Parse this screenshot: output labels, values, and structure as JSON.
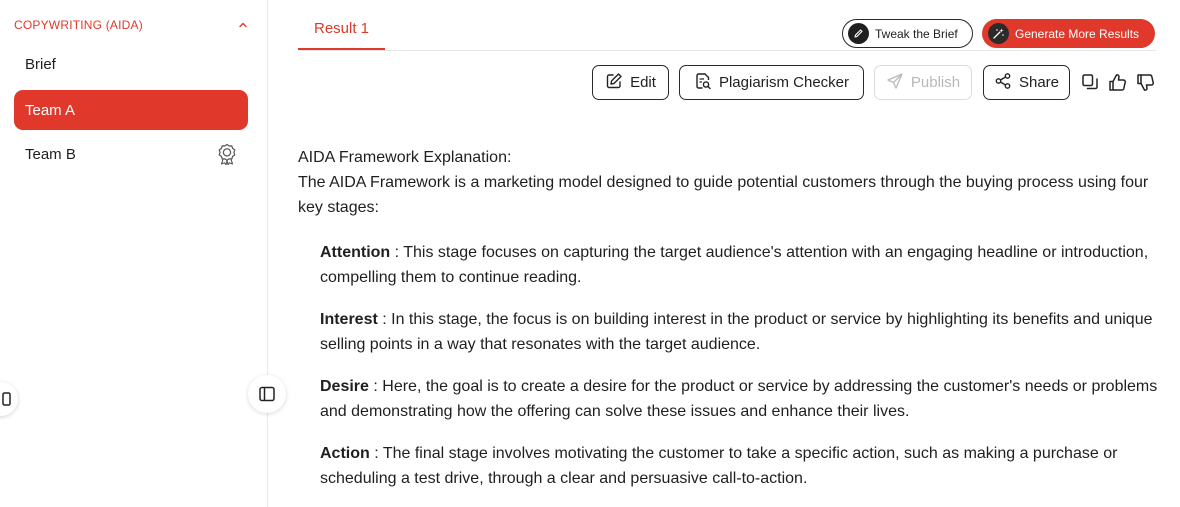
{
  "sidebar": {
    "section_title": "COPYWRITING (AIDA)",
    "items": [
      {
        "label": "Brief"
      },
      {
        "label": "Team A"
      },
      {
        "label": "Team B"
      }
    ]
  },
  "main": {
    "tabs": [
      {
        "label": "Result 1"
      }
    ],
    "actions": {
      "tweak_label": "Tweak the Brief",
      "generate_label": "Generate More Results"
    },
    "toolbar": {
      "edit_label": "Edit",
      "plagiarism_label": "Plagiarism Checker",
      "publish_label": "Publish",
      "share_label": "Share"
    },
    "content": {
      "heading": "AIDA Framework Explanation:",
      "intro": "The AIDA Framework is a marketing model designed to guide potential customers through the buying process using four key stages:",
      "stages": [
        {
          "title": "Attention",
          "text": " : This stage focuses on capturing the target audience's attention with an engaging headline or introduction, compelling them to continue reading."
        },
        {
          "title": "Interest",
          "text": " : In this stage, the focus is on building interest in the product or service by highlighting its benefits and unique selling points in a way that resonates with the target audience."
        },
        {
          "title": "Desire",
          "text": " : Here, the goal is to create a desire for the product or service by addressing the customer's needs or problems and demonstrating how the offering can solve these issues and enhance their lives."
        },
        {
          "title": "Action",
          "text": " : The final stage involves motivating the customer to take a specific action, such as making a purchase or scheduling a test drive, through a clear and persuasive call-to-action."
        }
      ]
    }
  },
  "colors": {
    "accent": "#e0392b",
    "text": "#1f1f1f",
    "disabled": "#b8b8b8"
  },
  "icons": {
    "section_toggle": "chevron-up-icon",
    "team_b_badge": "award-badge-icon",
    "tweak": "pencil-icon",
    "generate": "sparkle-wand-icon",
    "edit": "edit-icon",
    "plagiarism": "document-search-icon",
    "publish": "send-icon",
    "share": "share-icon",
    "copy": "copy-icon",
    "like": "thumbs-up-icon",
    "dislike": "thumbs-down-icon",
    "sidebar_toggle": "sidebar-panel-icon"
  }
}
